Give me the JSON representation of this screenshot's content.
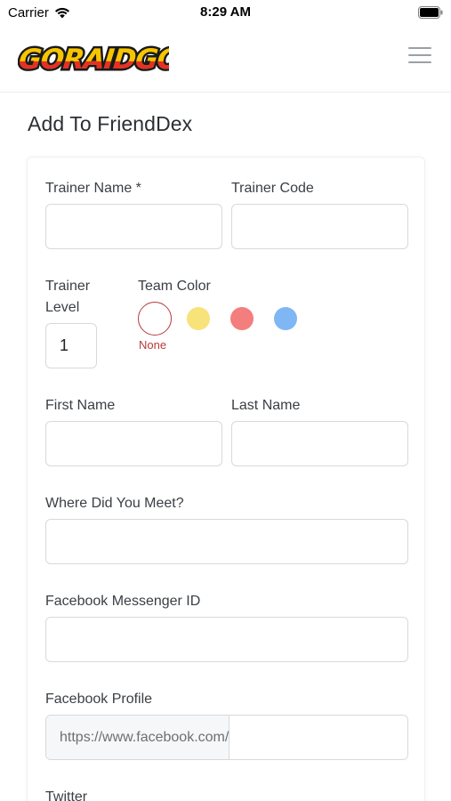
{
  "status_bar": {
    "carrier": "Carrier",
    "time": "8:29 AM"
  },
  "header": {
    "logo_text": "GORAIDGO",
    "menu_icon": "hamburger-icon"
  },
  "page": {
    "title": "Add To FriendDex"
  },
  "form": {
    "trainer_name": {
      "label": "Trainer Name *",
      "value": ""
    },
    "trainer_code": {
      "label": "Trainer Code",
      "value": ""
    },
    "trainer_level": {
      "label_line1": "Trainer",
      "label_line2": "Level",
      "value": "1"
    },
    "team_color": {
      "label": "Team Color",
      "selected_caption": "None",
      "options": [
        {
          "name": "none",
          "color": "#ffffff",
          "selected": true
        },
        {
          "name": "yellow",
          "color": "#f8e27a"
        },
        {
          "name": "red",
          "color": "#f47d7d"
        },
        {
          "name": "blue",
          "color": "#7fb7f4"
        }
      ]
    },
    "first_name": {
      "label": "First Name",
      "value": ""
    },
    "last_name": {
      "label": "Last Name",
      "value": ""
    },
    "where_met": {
      "label": "Where Did You Meet?",
      "value": ""
    },
    "messenger_id": {
      "label": "Facebook Messenger ID",
      "value": ""
    },
    "facebook_profile": {
      "label": "Facebook Profile",
      "prefix": "https://www.facebook.com/",
      "value": ""
    },
    "twitter": {
      "label": "Twitter"
    }
  },
  "colors": {
    "accent_red": "#b83a3a",
    "border": "#d6d9dc"
  }
}
